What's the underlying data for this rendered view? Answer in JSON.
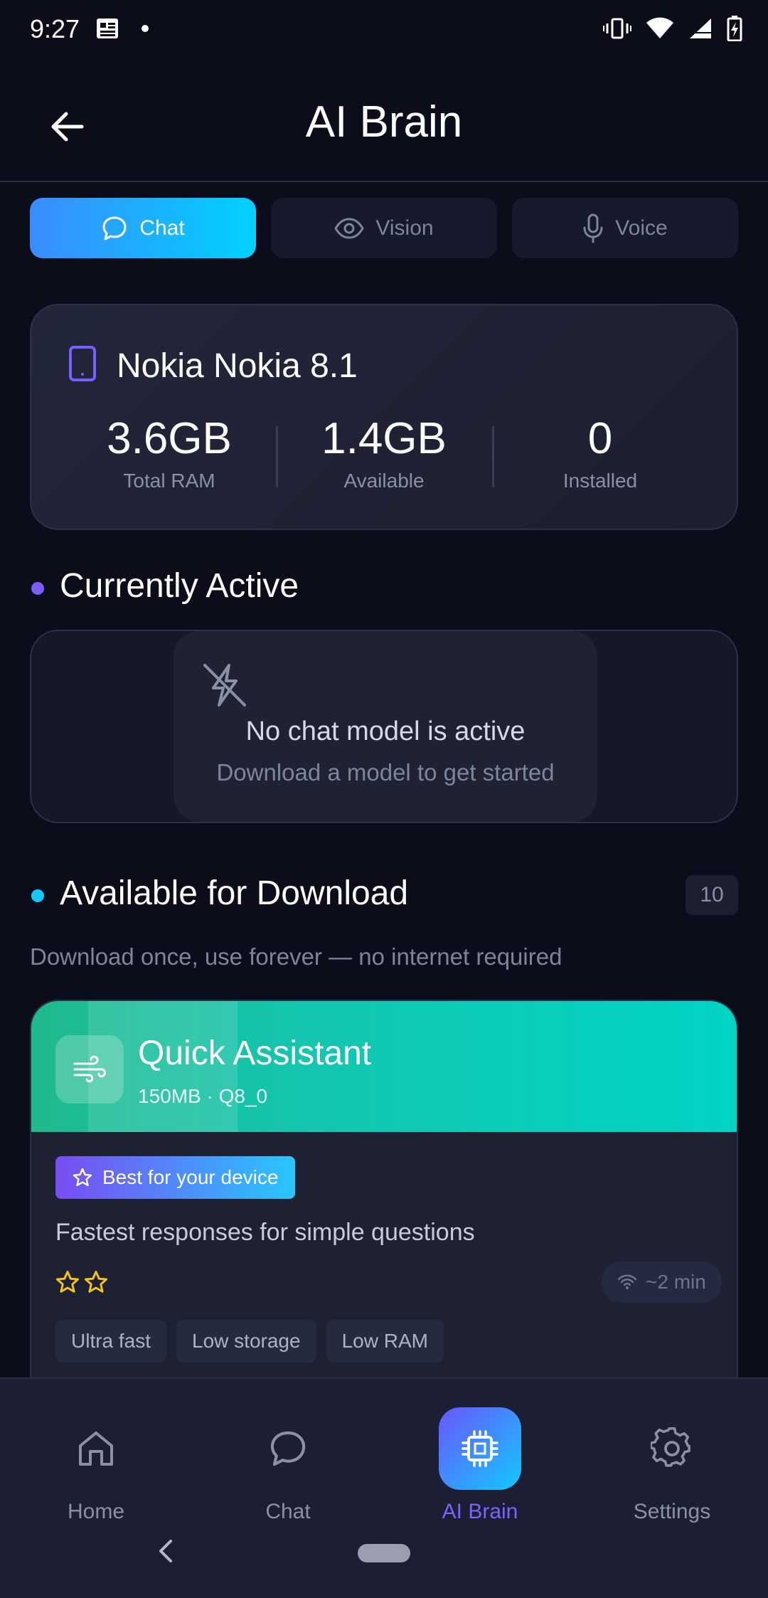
{
  "status_bar": {
    "time": "9:27"
  },
  "header": {
    "title": "AI Brain"
  },
  "tabs": [
    {
      "label": "Chat",
      "icon": "chat-bubble-icon",
      "active": true
    },
    {
      "label": "Vision",
      "icon": "eye-icon",
      "active": false
    },
    {
      "label": "Voice",
      "icon": "microphone-icon",
      "active": false
    }
  ],
  "device": {
    "name": "Nokia Nokia 8.1",
    "stats": [
      {
        "value": "3.6GB",
        "label": "Total RAM"
      },
      {
        "value": "1.4GB",
        "label": "Available"
      },
      {
        "value": "0",
        "label": "Installed"
      }
    ]
  },
  "active_section": {
    "title": "Currently Active",
    "empty_title": "No chat model is active",
    "empty_subtitle": "Download a model to get started"
  },
  "download_section": {
    "title": "Available for Download",
    "count": "10",
    "subtitle": "Download once, use forever — no internet required"
  },
  "model": {
    "name": "Quick Assistant",
    "meta": "150MB · Q8_0",
    "badge": "Best for your device",
    "description": "Fastest responses for simple questions",
    "rating_stars": 2,
    "time": "~2 min",
    "tags": [
      "Ultra fast",
      "Low storage",
      "Low RAM"
    ]
  },
  "bottom_nav": [
    {
      "label": "Home",
      "icon": "home-icon",
      "active": false
    },
    {
      "label": "Chat",
      "icon": "chat-bubble-icon",
      "active": false
    },
    {
      "label": "AI Brain",
      "icon": "cpu-chip-icon",
      "active": true
    },
    {
      "label": "Settings",
      "icon": "gear-icon",
      "active": false
    }
  ],
  "colors": {
    "background": "#0b0e1a",
    "accent_purple": "#7a63ff",
    "accent_cyan": "#12c9ff",
    "model_header": "#12c6b0"
  }
}
